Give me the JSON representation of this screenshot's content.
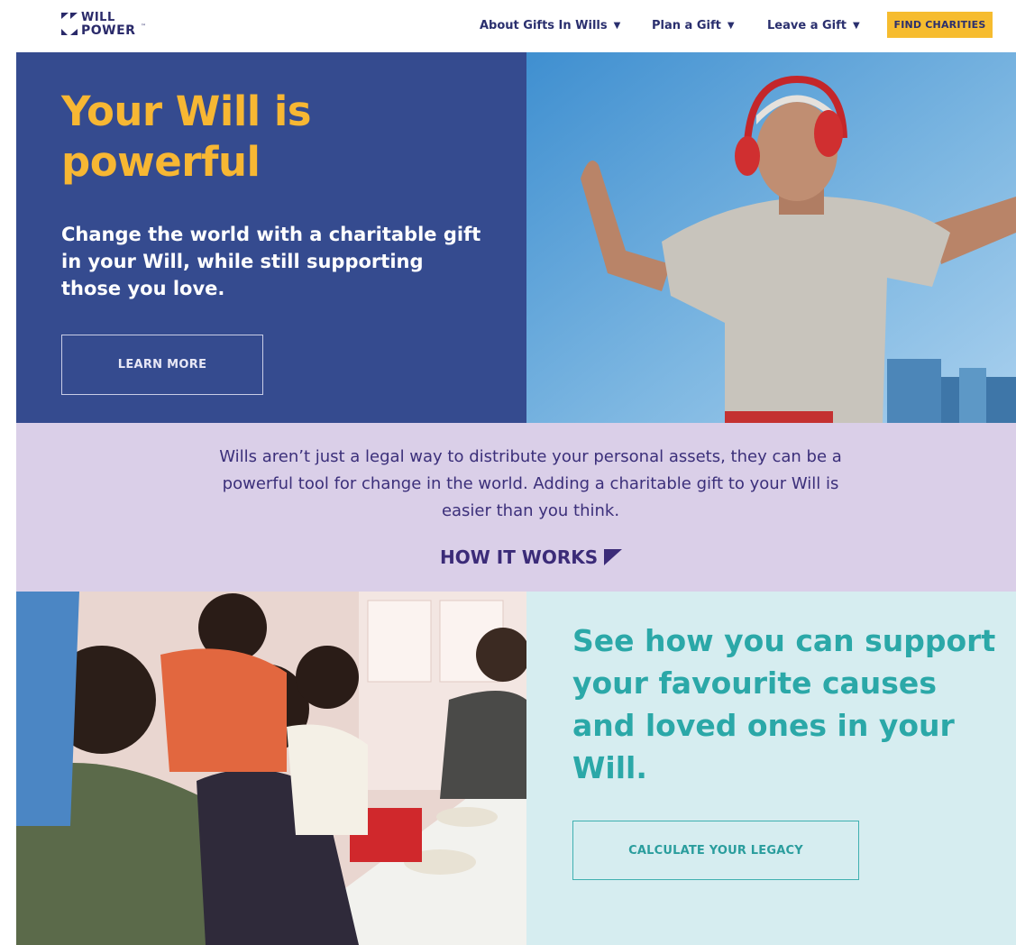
{
  "brand": {
    "logo_line1": "WILL",
    "logo_line2": "POWER",
    "logo_tm": "™"
  },
  "nav": {
    "items": [
      {
        "label": "About Gifts In Wills",
        "caret": "▼"
      },
      {
        "label": "Plan a Gift",
        "caret": "▼"
      },
      {
        "label": "Leave a Gift",
        "caret": "▼"
      }
    ],
    "cta_label": "FIND CHARITIES"
  },
  "hero": {
    "title": "Your Will is powerful",
    "subtitle": "Change the world with a charitable gift in your Will, while still supporting those you love.",
    "button_label": "LEARN MORE"
  },
  "band": {
    "text": "Wills aren’t just a legal way to distribute your personal assets, they can be a powerful tool for change in the world. Adding a charitable gift to your Will is easier than you think.",
    "link_label": "HOW IT WORKS"
  },
  "calculator": {
    "title": "See how you can support your favourite causes and loved ones in your Will.",
    "button_label": "CALCULATE YOUR LEGACY"
  },
  "colors": {
    "navy": "#354b8f",
    "gold": "#f7b733",
    "button_gold": "#f6bc2f",
    "lavender": "#dacfe8",
    "purple_text": "#3b2b78",
    "mint": "#d6edf0",
    "teal": "#2ba8a8"
  }
}
